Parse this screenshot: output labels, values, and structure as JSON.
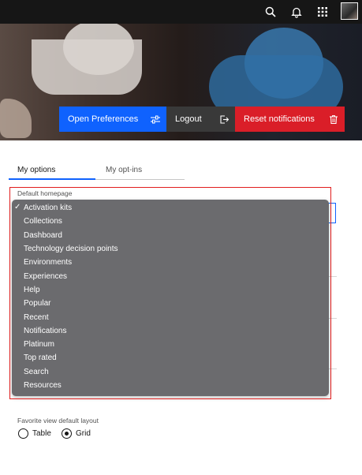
{
  "header": {
    "icons": [
      "search-icon",
      "notification-icon",
      "app-switcher-icon"
    ],
    "avatar": "user-avatar"
  },
  "hero": {
    "buttons": [
      {
        "label": "Open Preferences",
        "icon": "settings-adjust-icon",
        "color": "#0f62fe"
      },
      {
        "label": "Logout",
        "icon": "logout-icon",
        "color": "#393939"
      },
      {
        "label": "Reset notifications",
        "icon": "trash-icon",
        "color": "#da1e28"
      }
    ]
  },
  "tabs": [
    {
      "label": "My options",
      "active": true
    },
    {
      "label": "My opt-ins",
      "active": false
    }
  ],
  "homepage": {
    "label": "Default homepage",
    "selected": "Activation kits",
    "check_mark": "✓",
    "options": [
      "Activation kits",
      "Collections",
      "Dashboard",
      "Technology decision points",
      "Environments",
      "Experiences",
      "Help",
      "Popular",
      "Recent",
      "Notifications",
      "Platinum",
      "Top rated",
      "Search",
      "Resources"
    ]
  },
  "favorite_layout": {
    "label": "Favorite view default layout",
    "options": [
      {
        "label": "Table",
        "checked": false
      },
      {
        "label": "Grid",
        "checked": true
      }
    ]
  },
  "colors": {
    "accent": "#0f62fe",
    "danger": "#da1e28",
    "highlight_frame": "#e11d1d",
    "menu_bg": "#6b6b6e"
  }
}
